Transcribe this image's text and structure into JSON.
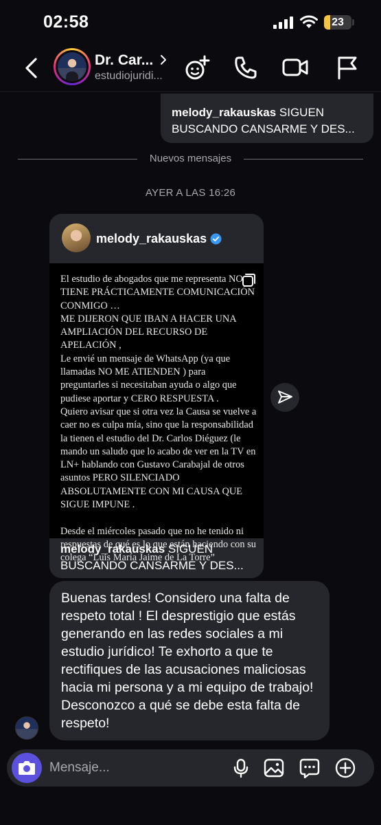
{
  "status_bar": {
    "time": "02:58",
    "battery": "23",
    "battery_level": 0.23
  },
  "header": {
    "contact_name": "Dr. Car...",
    "contact_username": "estudiojuridi..."
  },
  "reply_snippet": {
    "username": "melody_rakauskas",
    "text": "SIGUEN BUSCANDO CANSARME Y DES..."
  },
  "divider_text": "Nuevos mensajes",
  "timestamp": "AYER A LAS 16:26",
  "shared_post": {
    "username": "melody_rakauskas",
    "verified": true,
    "body": "El estudio de abogados que me representa NO TIENE PRÁCTICAMENTE COMUNICACIÓN CONMIGO …\nME DIJERON QUE IBAN A HACER UNA AMPLIACIÓN DEL RECURSO DE APELACIÓN ,\nLe envié un mensaje de WhatsApp (ya que llamadas NO ME ATIENDEN ) para preguntarles si necesitaban ayuda o algo que pudiese aportar y CERO RESPUESTA .\nQuiero avisar que si otra vez la Causa se vuelve a caer no es culpa mía, sino que la responsabilidad la tienen el estudio del Dr. Carlos Diéguez (le mando un saludo que lo acabo de ver en la TV en LN+ hablando con Gustavo Carabajal de otros asuntos PERO SILENCIADO ABSOLUTAMENTE CON MI CAUSA QUE SIGUE IMPUNE .\n\nDesde el miércoles pasado que no he tenido ni respuestas de qué es lo que están haciendo con su colega “Luis María Jaime de La Torre”",
    "caption_username": "melody_rakauskas",
    "caption_text": "SIGUEN BUSCANDO CANSARME Y DES..."
  },
  "message": {
    "text": "Buenas tardes! Considero una falta de respeto total ! El desprestigio que estás generando en las redes sociales a mi estudio jurídico! Te exhorto a que  te rectifiques de las acusaciones maliciosas hacia mi persona y a mi equipo de trabajo! Desconozco a qué se debe esta falta de respeto!"
  },
  "composer": {
    "placeholder": "Mensaje..."
  },
  "colors": {
    "background": "#0b0b0f",
    "bubble": "#26272c",
    "camera": "#5b51de",
    "verified": "#3897f0",
    "battery": "#f5c542"
  }
}
